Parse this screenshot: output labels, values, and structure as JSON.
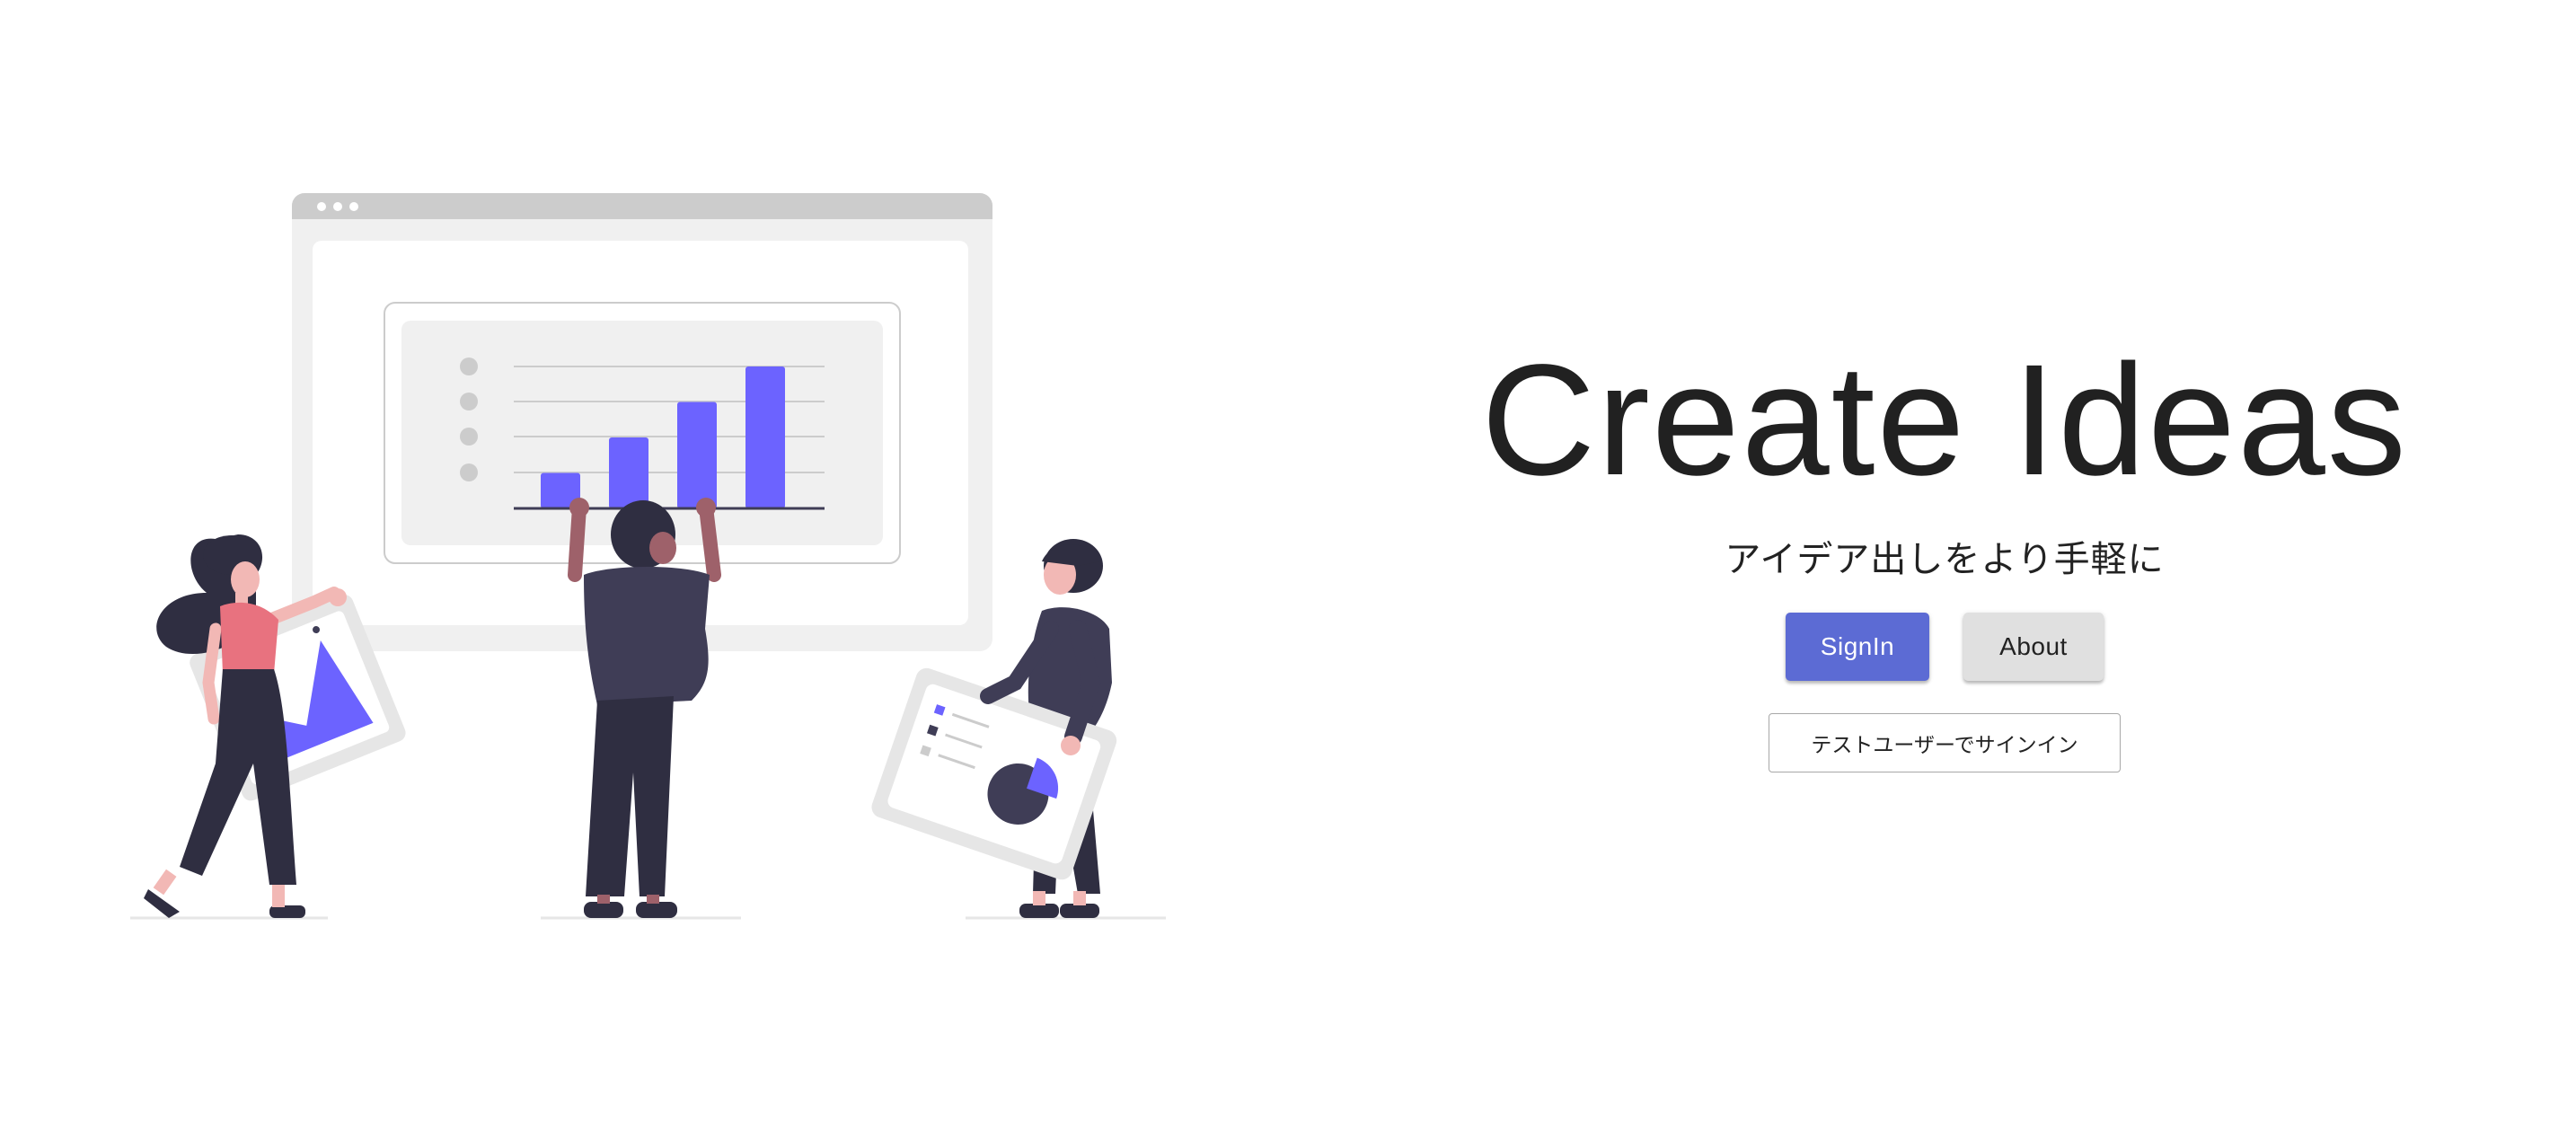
{
  "hero": {
    "title": "Create Ideas",
    "subtitle": "アイデア出しをより手軽に"
  },
  "buttons": {
    "signin_label": "SignIn",
    "about_label": "About",
    "test_user_label": "テストユーザーでサインイン"
  },
  "colors": {
    "accent": "#6c63ff",
    "primary_button": "#5c6bd4",
    "secondary_button": "#e0e0e0",
    "title_text": "#212121",
    "figure_dark": "#2f2e41",
    "figure_pink": "#e8727f",
    "skin_light": "#f2b8b5",
    "skin_dark": "#9e616a",
    "panel_gray": "#f0f0f0",
    "frame_gray": "#cccccc"
  },
  "illustration": {
    "name": "team-analytics-illustration",
    "bar_chart_values": [
      1,
      2,
      3,
      4
    ]
  }
}
